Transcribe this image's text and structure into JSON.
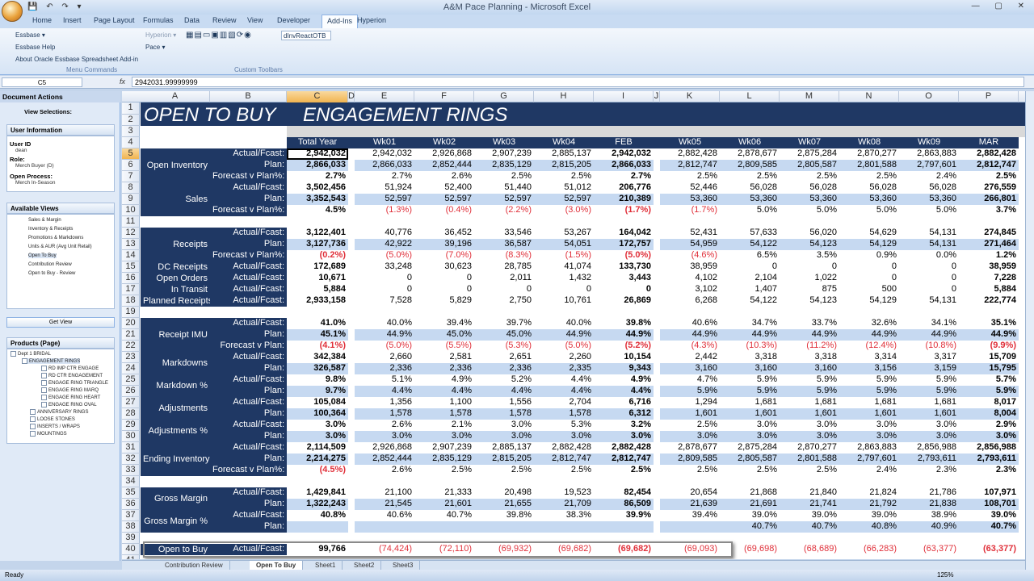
{
  "app": {
    "title": "A&M Pace Planning - Microsoft Excel",
    "tabs": [
      "Home",
      "Insert",
      "Page Layout",
      "Formulas",
      "Data",
      "Review",
      "View",
      "Developer",
      "Add-Ins",
      "Hyperion"
    ],
    "active_tab": "Add-Ins"
  },
  "ribbon": {
    "menu": [
      "Essbase ▾",
      "Essbase Help",
      "About Oracle Essbase Spreadsheet Add-in"
    ],
    "hyperion": "Hyperion ▾",
    "pace": "Pace ▾",
    "combo": "dInvReactOTB",
    "group1": "Menu Commands",
    "group2": "Custom Toolbars"
  },
  "formula_bar": {
    "name_box": "C5",
    "fx": "fx",
    "value": "2942031.99999999"
  },
  "pane": {
    "title": "Document Actions",
    "view_selections": "View Selections:",
    "user_info_title": "User Information",
    "user_id_label": "User ID",
    "user_id": "dean",
    "role_label": "Role:",
    "role": "Merch Buyer (D)",
    "open_process_label": "Open Process:",
    "open_process": "Merch In-Season",
    "views_title": "Available Views",
    "views": [
      "Sales & Margin",
      "Inventory & Receipts",
      "Promotions & Markdowns",
      "Units & AUR (Avg Unit Retail)",
      "Open To Buy",
      "Contribution Review",
      "Open to Buy - Review"
    ],
    "get_view": "Get View",
    "products_title": "Products (Page)",
    "tree": [
      "Dept 1 BRIDAL",
      "ENGAGEMENT RINGS",
      "RD IMP CTR ENGAGE",
      "RD CTR ENGAGEMENT",
      "ENGAGE RING TRIANGLE",
      "ENGAGE RING MARQ",
      "ENGAGE RING HEART",
      "ENGAGE RING OVAL",
      "ANNIVERSARY RINGS",
      "LOOSE STONES",
      "INSERTS / WRAPS",
      "MOUNTINGS"
    ]
  },
  "sheet": {
    "columns": [
      "A",
      "B",
      "C",
      "D",
      "E",
      "F",
      "G",
      "H",
      "I",
      "J",
      "K",
      "L",
      "M",
      "N",
      "O",
      "P"
    ],
    "title_left": "OPEN TO BUY",
    "title_right": "ENGAGEMENT RINGS",
    "headers": [
      "Total Year",
      "Wk01",
      "Wk02",
      "Wk03",
      "Wk04",
      "FEB",
      "Wk05",
      "Wk06",
      "Wk07",
      "Wk08",
      "Wk09",
      "MAR"
    ],
    "rows": [
      {
        "r": 5,
        "a": "Open Inventory",
        "b": "Actual/Fcast:",
        "v": [
          "2,942,032",
          "2,942,032",
          "2,926,868",
          "2,907,239",
          "2,885,137",
          "2,942,032",
          "2,882,428",
          "2,878,677",
          "2,875,284",
          "2,870,277",
          "2,863,883",
          "2,882,428"
        ]
      },
      {
        "r": 6,
        "a": "",
        "b": "Plan:",
        "v": [
          "2,866,033",
          "2,866,033",
          "2,852,444",
          "2,835,129",
          "2,815,205",
          "2,866,033",
          "2,812,747",
          "2,809,585",
          "2,805,587",
          "2,801,588",
          "2,797,601",
          "2,812,747"
        ]
      },
      {
        "r": 7,
        "a": "",
        "b": "Forecast v Plan%:",
        "v": [
          "2.7%",
          "2.7%",
          "2.6%",
          "2.5%",
          "2.5%",
          "2.7%",
          "2.5%",
          "2.5%",
          "2.5%",
          "2.5%",
          "2.4%",
          "2.5%"
        ]
      },
      {
        "r": 8,
        "a": "Sales",
        "b": "Actual/Fcast:",
        "v": [
          "3,502,456",
          "51,924",
          "52,400",
          "51,440",
          "51,012",
          "206,776",
          "52,446",
          "56,028",
          "56,028",
          "56,028",
          "56,028",
          "276,559"
        ]
      },
      {
        "r": 9,
        "a": "",
        "b": "Plan:",
        "v": [
          "3,352,543",
          "52,597",
          "52,597",
          "52,597",
          "52,597",
          "210,389",
          "53,360",
          "53,360",
          "53,360",
          "53,360",
          "53,360",
          "266,801"
        ]
      },
      {
        "r": 10,
        "a": "",
        "b": "Forecast v Plan%:",
        "v": [
          "4.5%",
          "(1.3%)",
          "(0.4%)",
          "(2.2%)",
          "(3.0%)",
          "(1.7%)",
          "(1.7%)",
          "5.0%",
          "5.0%",
          "5.0%",
          "5.0%",
          "3.7%"
        ]
      },
      {
        "r": 12,
        "a": "Receipts",
        "b": "Actual/Fcast:",
        "v": [
          "3,122,401",
          "40,776",
          "36,452",
          "33,546",
          "53,267",
          "164,042",
          "52,431",
          "57,633",
          "56,020",
          "54,629",
          "54,131",
          "274,845"
        ]
      },
      {
        "r": 13,
        "a": "",
        "b": "Plan:",
        "v": [
          "3,127,736",
          "42,922",
          "39,196",
          "36,587",
          "54,051",
          "172,757",
          "54,959",
          "54,122",
          "54,123",
          "54,129",
          "54,131",
          "271,464"
        ]
      },
      {
        "r": 14,
        "a": "",
        "b": "Forecast v Plan%:",
        "v": [
          "(0.2%)",
          "(5.0%)",
          "(7.0%)",
          "(8.3%)",
          "(1.5%)",
          "(5.0%)",
          "(4.6%)",
          "6.5%",
          "3.5%",
          "0.9%",
          "0.0%",
          "1.2%"
        ]
      },
      {
        "r": 15,
        "a": "DC Receipts",
        "b": "Actual/Fcast:",
        "v": [
          "172,689",
          "33,248",
          "30,623",
          "28,785",
          "41,074",
          "133,730",
          "38,959",
          "0",
          "0",
          "0",
          "0",
          "38,959"
        ]
      },
      {
        "r": 16,
        "a": "Open Orders",
        "b": "Actual/Fcast:",
        "v": [
          "10,671",
          "0",
          "0",
          "2,011",
          "1,432",
          "3,443",
          "4,102",
          "2,104",
          "1,022",
          "0",
          "0",
          "7,228"
        ]
      },
      {
        "r": 17,
        "a": "In Transit",
        "b": "Actual/Fcast:",
        "v": [
          "5,884",
          "0",
          "0",
          "0",
          "0",
          "0",
          "3,102",
          "1,407",
          "875",
          "500",
          "0",
          "5,884"
        ]
      },
      {
        "r": 18,
        "a": "Planned Receipts",
        "b": "Actual/Fcast:",
        "v": [
          "2,933,158",
          "7,528",
          "5,829",
          "2,750",
          "10,761",
          "26,869",
          "6,268",
          "54,122",
          "54,123",
          "54,129",
          "54,131",
          "222,774"
        ]
      },
      {
        "r": 20,
        "a": "Receipt IMU",
        "b": "Actual/Fcast:",
        "v": [
          "41.0%",
          "40.0%",
          "39.4%",
          "39.7%",
          "40.0%",
          "39.8%",
          "40.6%",
          "34.7%",
          "33.7%",
          "32.6%",
          "34.1%",
          "35.1%"
        ]
      },
      {
        "r": 21,
        "a": "",
        "b": "Plan:",
        "v": [
          "45.1%",
          "44.9%",
          "45.0%",
          "45.0%",
          "44.9%",
          "44.9%",
          "44.9%",
          "44.9%",
          "44.9%",
          "44.9%",
          "44.9%",
          "44.9%"
        ]
      },
      {
        "r": 22,
        "a": "",
        "b": "Forecast v Plan:",
        "v": [
          "(4.1%)",
          "(5.0%)",
          "(5.5%)",
          "(5.3%)",
          "(5.0%)",
          "(5.2%)",
          "(4.3%)",
          "(10.3%)",
          "(11.2%)",
          "(12.4%)",
          "(10.8%)",
          "(9.9%)"
        ]
      },
      {
        "r": 23,
        "a": "Markdowns",
        "b": "Actual/Fcast:",
        "v": [
          "342,384",
          "2,660",
          "2,581",
          "2,651",
          "2,260",
          "10,154",
          "2,442",
          "3,318",
          "3,318",
          "3,314",
          "3,317",
          "15,709"
        ]
      },
      {
        "r": 24,
        "a": "",
        "b": "Plan:",
        "v": [
          "326,587",
          "2,336",
          "2,336",
          "2,336",
          "2,335",
          "9,343",
          "3,160",
          "3,160",
          "3,160",
          "3,156",
          "3,159",
          "15,795"
        ]
      },
      {
        "r": 25,
        "a": "Markdown %",
        "b": "Actual/Fcast:",
        "v": [
          "9.8%",
          "5.1%",
          "4.9%",
          "5.2%",
          "4.4%",
          "4.9%",
          "4.7%",
          "5.9%",
          "5.9%",
          "5.9%",
          "5.9%",
          "5.7%"
        ]
      },
      {
        "r": 26,
        "a": "",
        "b": "Plan:",
        "v": [
          "9.7%",
          "4.4%",
          "4.4%",
          "4.4%",
          "4.4%",
          "4.4%",
          "5.9%",
          "5.9%",
          "5.9%",
          "5.9%",
          "5.9%",
          "5.9%"
        ]
      },
      {
        "r": 27,
        "a": "Adjustments",
        "b": "Actual/Fcast:",
        "v": [
          "105,084",
          "1,356",
          "1,100",
          "1,556",
          "2,704",
          "6,716",
          "1,294",
          "1,681",
          "1,681",
          "1,681",
          "1,681",
          "8,017"
        ]
      },
      {
        "r": 28,
        "a": "",
        "b": "Plan:",
        "v": [
          "100,364",
          "1,578",
          "1,578",
          "1,578",
          "1,578",
          "6,312",
          "1,601",
          "1,601",
          "1,601",
          "1,601",
          "1,601",
          "8,004"
        ]
      },
      {
        "r": 29,
        "a": "Adjustments %",
        "b": "Actual/Fcast:",
        "v": [
          "3.0%",
          "2.6%",
          "2.1%",
          "3.0%",
          "5.3%",
          "3.2%",
          "2.5%",
          "3.0%",
          "3.0%",
          "3.0%",
          "3.0%",
          "2.9%"
        ]
      },
      {
        "r": 30,
        "a": "",
        "b": "Plan:",
        "v": [
          "3.0%",
          "3.0%",
          "3.0%",
          "3.0%",
          "3.0%",
          "3.0%",
          "3.0%",
          "3.0%",
          "3.0%",
          "3.0%",
          "3.0%",
          "3.0%"
        ]
      },
      {
        "r": 31,
        "a": "Ending Inventory",
        "b": "Actual/Fcast:",
        "v": [
          "2,114,509",
          "2,926,868",
          "2,907,239",
          "2,885,137",
          "2,882,428",
          "2,882,428",
          "2,878,677",
          "2,875,284",
          "2,870,277",
          "2,863,883",
          "2,856,988",
          "2,856,988"
        ]
      },
      {
        "r": 32,
        "a": "",
        "b": "Plan:",
        "v": [
          "2,214,275",
          "2,852,444",
          "2,835,129",
          "2,815,205",
          "2,812,747",
          "2,812,747",
          "2,809,585",
          "2,805,587",
          "2,801,588",
          "2,797,601",
          "2,793,611",
          "2,793,611"
        ]
      },
      {
        "r": 33,
        "a": "",
        "b": "Forecast v Plan%:",
        "v": [
          "(4.5%)",
          "2.6%",
          "2.5%",
          "2.5%",
          "2.5%",
          "2.5%",
          "2.5%",
          "2.5%",
          "2.5%",
          "2.4%",
          "2.3%",
          "2.3%"
        ]
      },
      {
        "r": 35,
        "a": "Gross Margin",
        "b": "Actual/Fcast:",
        "v": [
          "1,429,841",
          "21,100",
          "21,333",
          "20,498",
          "19,523",
          "82,454",
          "20,654",
          "21,868",
          "21,840",
          "21,824",
          "21,786",
          "107,971"
        ]
      },
      {
        "r": 36,
        "a": "",
        "b": "Plan:",
        "v": [
          "1,322,243",
          "21,545",
          "21,601",
          "21,655",
          "21,709",
          "86,509",
          "21,639",
          "21,691",
          "21,741",
          "21,792",
          "21,838",
          "108,701"
        ]
      },
      {
        "r": 37,
        "a": "Gross Margin %",
        "b": "Actual/Fcast:",
        "v": [
          "40.8%",
          "40.6%",
          "40.7%",
          "39.8%",
          "38.3%",
          "39.9%",
          "39.4%",
          "39.0%",
          "39.0%",
          "39.0%",
          "38.9%",
          "39.0%"
        ]
      },
      {
        "r": 38,
        "a": "",
        "b": "Plan:",
        "v": [
          "",
          "",
          "",
          "",
          "",
          "",
          "",
          "40.7%",
          "40.7%",
          "40.8%",
          "40.9%",
          "40.7%"
        ]
      },
      {
        "r": 40,
        "a": "Open to Buy",
        "b": "Actual/Fcast:",
        "v": [
          "99,766",
          "(74,424)",
          "(72,110)",
          "(69,932)",
          "(69,682)",
          "(69,682)",
          "(69,093)",
          "(69,698)",
          "(68,689)",
          "(66,283)",
          "(63,377)",
          "(63,377)"
        ]
      }
    ],
    "bold_cols": [
      0,
      5,
      11
    ]
  },
  "sheet_tabs": [
    "Contribution Review",
    "Open To Buy",
    "Sheet1",
    "Sheet2",
    "Sheet3"
  ],
  "active_sheet": "Open To Buy",
  "status": {
    "left": "Ready",
    "zoom": "125%"
  }
}
